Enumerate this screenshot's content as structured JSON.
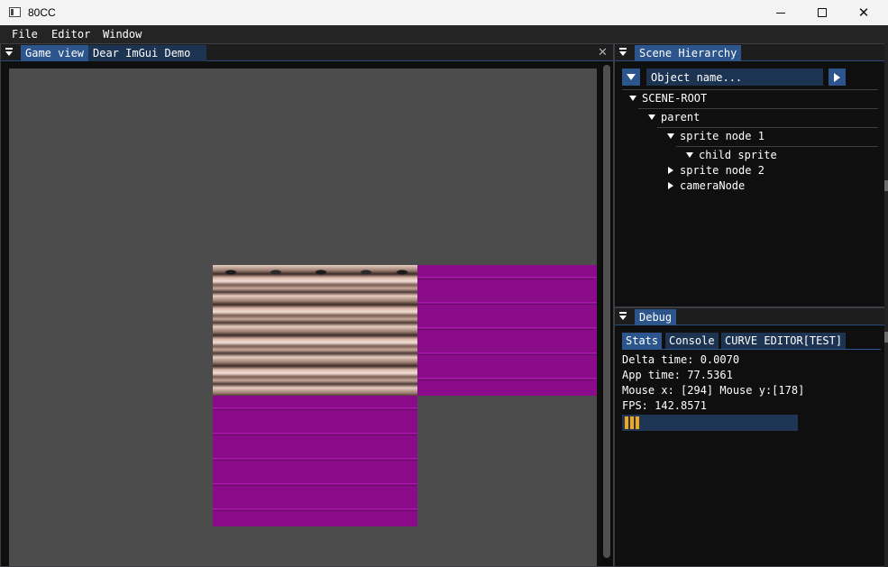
{
  "window": {
    "title": "80CC",
    "minimize_label": "",
    "close_label": "✕"
  },
  "menu": {
    "items": [
      "File",
      "Editor",
      "Window"
    ]
  },
  "game_panel": {
    "tabs": [
      "Game view",
      "Dear ImGui Demo"
    ],
    "active_tab": 0,
    "close_label": "✕"
  },
  "scene_hierarchy": {
    "tab": "Scene Hierarchy",
    "filter": {
      "placeholder": "Object name...",
      "value": ""
    },
    "nodes": [
      {
        "label": "SCENE-ROOT",
        "depth": 0,
        "expanded": true
      },
      {
        "label": "parent",
        "depth": 1,
        "expanded": true
      },
      {
        "label": "sprite node 1",
        "depth": 2,
        "expanded": true
      },
      {
        "label": "child sprite",
        "depth": 3,
        "expanded": true
      },
      {
        "label": "sprite node 2",
        "depth": 2,
        "expanded": false
      },
      {
        "label": "cameraNode",
        "depth": 2,
        "expanded": false
      }
    ]
  },
  "debug": {
    "tab": "Debug",
    "subtabs": [
      "Stats",
      "Console",
      "CURVE EDITOR[TEST]"
    ],
    "active_subtab": 0,
    "stats": {
      "delta_time": "Delta time: 0.0070",
      "app_time": "App time: 77.5361",
      "mouse": "Mouse x: [294] Mouse y:[178]",
      "fps": "FPS: 142.8571"
    },
    "fps_bar_fraction": 0.1
  },
  "colors": {
    "accent": "#2b558c",
    "tab_inactive": "#1c3352",
    "panel_bg": "#0f0f0f",
    "canvas_bg": "#4c4c4c",
    "sprite_magenta": "#8a0c8a",
    "fps_bar_fill": "#f0a818"
  }
}
